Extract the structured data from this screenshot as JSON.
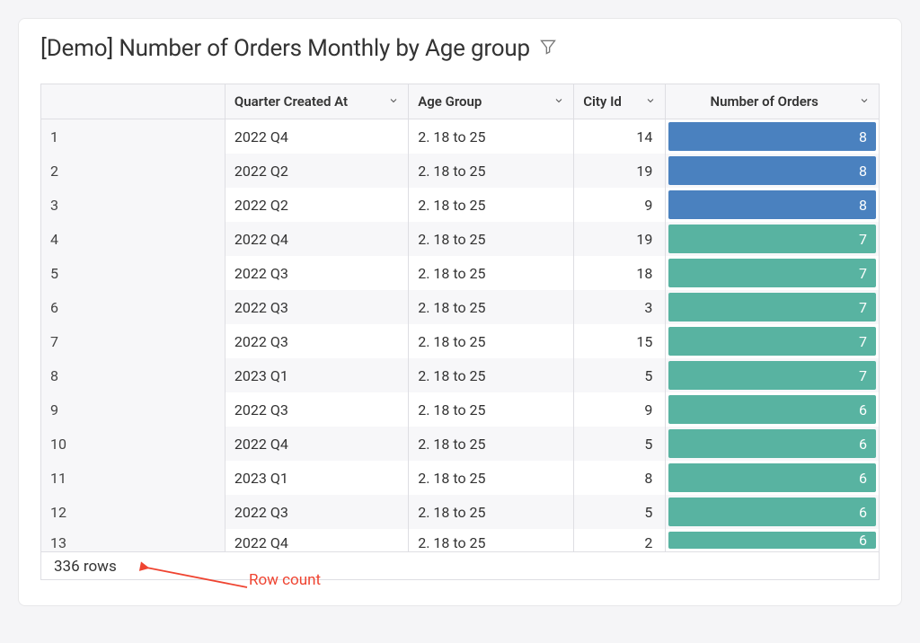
{
  "title": "[Demo] Number of Orders Monthly by Age group",
  "columns": {
    "quarter": "Quarter Created At",
    "age_group": "Age Group",
    "city_id": "City Id",
    "num_orders": "Number of Orders"
  },
  "rows": [
    {
      "idx": "1",
      "quarter": "2022 Q4",
      "age_group": "2. 18 to 25",
      "city_id": "14",
      "orders": "8",
      "bar_color": "blue"
    },
    {
      "idx": "2",
      "quarter": "2022 Q2",
      "age_group": "2. 18 to 25",
      "city_id": "19",
      "orders": "8",
      "bar_color": "blue"
    },
    {
      "idx": "3",
      "quarter": "2022 Q2",
      "age_group": "2. 18 to 25",
      "city_id": "9",
      "orders": "8",
      "bar_color": "blue"
    },
    {
      "idx": "4",
      "quarter": "2022 Q4",
      "age_group": "2. 18 to 25",
      "city_id": "19",
      "orders": "7",
      "bar_color": "teal"
    },
    {
      "idx": "5",
      "quarter": "2022 Q3",
      "age_group": "2. 18 to 25",
      "city_id": "18",
      "orders": "7",
      "bar_color": "teal"
    },
    {
      "idx": "6",
      "quarter": "2022 Q3",
      "age_group": "2. 18 to 25",
      "city_id": "3",
      "orders": "7",
      "bar_color": "teal"
    },
    {
      "idx": "7",
      "quarter": "2022 Q3",
      "age_group": "2. 18 to 25",
      "city_id": "15",
      "orders": "7",
      "bar_color": "teal"
    },
    {
      "idx": "8",
      "quarter": "2023 Q1",
      "age_group": "2. 18 to 25",
      "city_id": "5",
      "orders": "7",
      "bar_color": "teal"
    },
    {
      "idx": "9",
      "quarter": "2022 Q3",
      "age_group": "2. 18 to 25",
      "city_id": "9",
      "orders": "6",
      "bar_color": "teal"
    },
    {
      "idx": "10",
      "quarter": "2022 Q4",
      "age_group": "2. 18 to 25",
      "city_id": "5",
      "orders": "6",
      "bar_color": "teal"
    },
    {
      "idx": "11",
      "quarter": "2023 Q1",
      "age_group": "2. 18 to 25",
      "city_id": "8",
      "orders": "6",
      "bar_color": "teal"
    },
    {
      "idx": "12",
      "quarter": "2022 Q3",
      "age_group": "2. 18 to 25",
      "city_id": "5",
      "orders": "6",
      "bar_color": "teal"
    },
    {
      "idx": "13",
      "quarter": "2022 Q4",
      "age_group": "2. 18 to 25",
      "city_id": "2",
      "orders": "6",
      "bar_color": "teal",
      "clipped": true
    }
  ],
  "footer": {
    "row_count_label": "336 rows"
  },
  "annotation": {
    "label": "Row count"
  },
  "colors": {
    "blue": "#4a81bf",
    "teal": "#58b3a1",
    "red": "#ef4431"
  }
}
